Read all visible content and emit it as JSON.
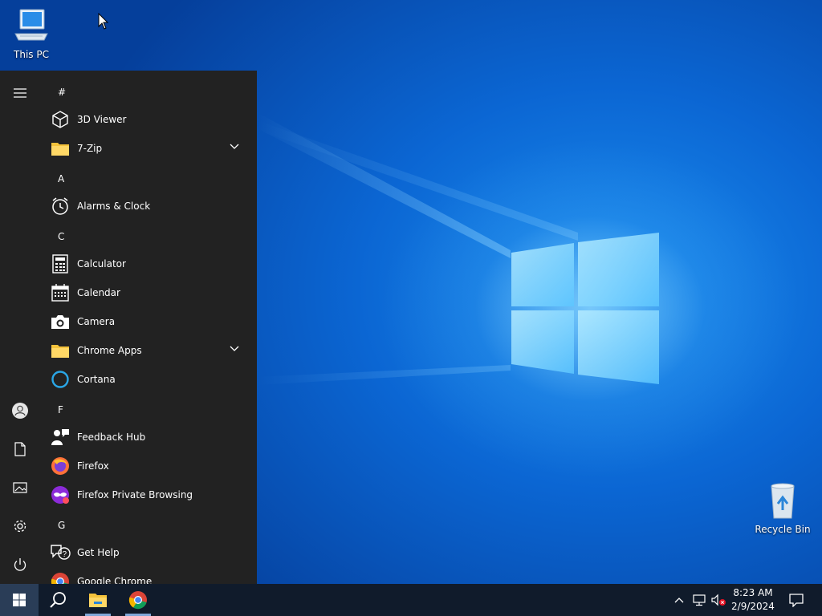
{
  "desktop": {
    "icons": [
      {
        "label": "This PC"
      },
      {
        "label": "Recycle Bin"
      }
    ]
  },
  "start_menu": {
    "groups": [
      {
        "header": "#",
        "apps": [
          {
            "label": "3D Viewer",
            "icon": "3d-viewer-icon"
          },
          {
            "label": "7-Zip",
            "icon": "folder-icon",
            "expandable": true
          }
        ]
      },
      {
        "header": "A",
        "apps": [
          {
            "label": "Alarms & Clock",
            "icon": "alarm-clock-icon"
          }
        ]
      },
      {
        "header": "C",
        "apps": [
          {
            "label": "Calculator",
            "icon": "calculator-icon"
          },
          {
            "label": "Calendar",
            "icon": "calendar-icon"
          },
          {
            "label": "Camera",
            "icon": "camera-icon"
          },
          {
            "label": "Chrome Apps",
            "icon": "folder-icon",
            "expandable": true
          },
          {
            "label": "Cortana",
            "icon": "cortana-icon"
          }
        ]
      },
      {
        "header": "F",
        "apps": [
          {
            "label": "Feedback Hub",
            "icon": "feedback-hub-icon"
          },
          {
            "label": "Firefox",
            "icon": "firefox-icon"
          },
          {
            "label": "Firefox Private Browsing",
            "icon": "firefox-private-icon"
          }
        ]
      },
      {
        "header": "G",
        "apps": [
          {
            "label": "Get Help",
            "icon": "get-help-icon"
          },
          {
            "label": "Google Chrome",
            "icon": "chrome-icon"
          }
        ]
      }
    ],
    "rail": [
      "hamburger-menu-icon",
      "user-account-icon",
      "documents-icon",
      "pictures-icon",
      "settings-gear-icon",
      "power-icon"
    ]
  },
  "taskbar": {
    "buttons": [
      "windows-start-icon",
      "search-icon",
      "file-explorer-icon",
      "chrome-icon"
    ],
    "tray": {
      "icons": [
        "chevron-up-icon",
        "network-icon",
        "volume-muted-icon"
      ],
      "time": "8:23 AM",
      "date": "2/9/2024"
    }
  },
  "colors": {
    "start_menu_bg": "#222222",
    "taskbar_bg": "#101b2b",
    "desktop_blue": "#0b66d3",
    "folder_yellow": "#f5c33b"
  }
}
